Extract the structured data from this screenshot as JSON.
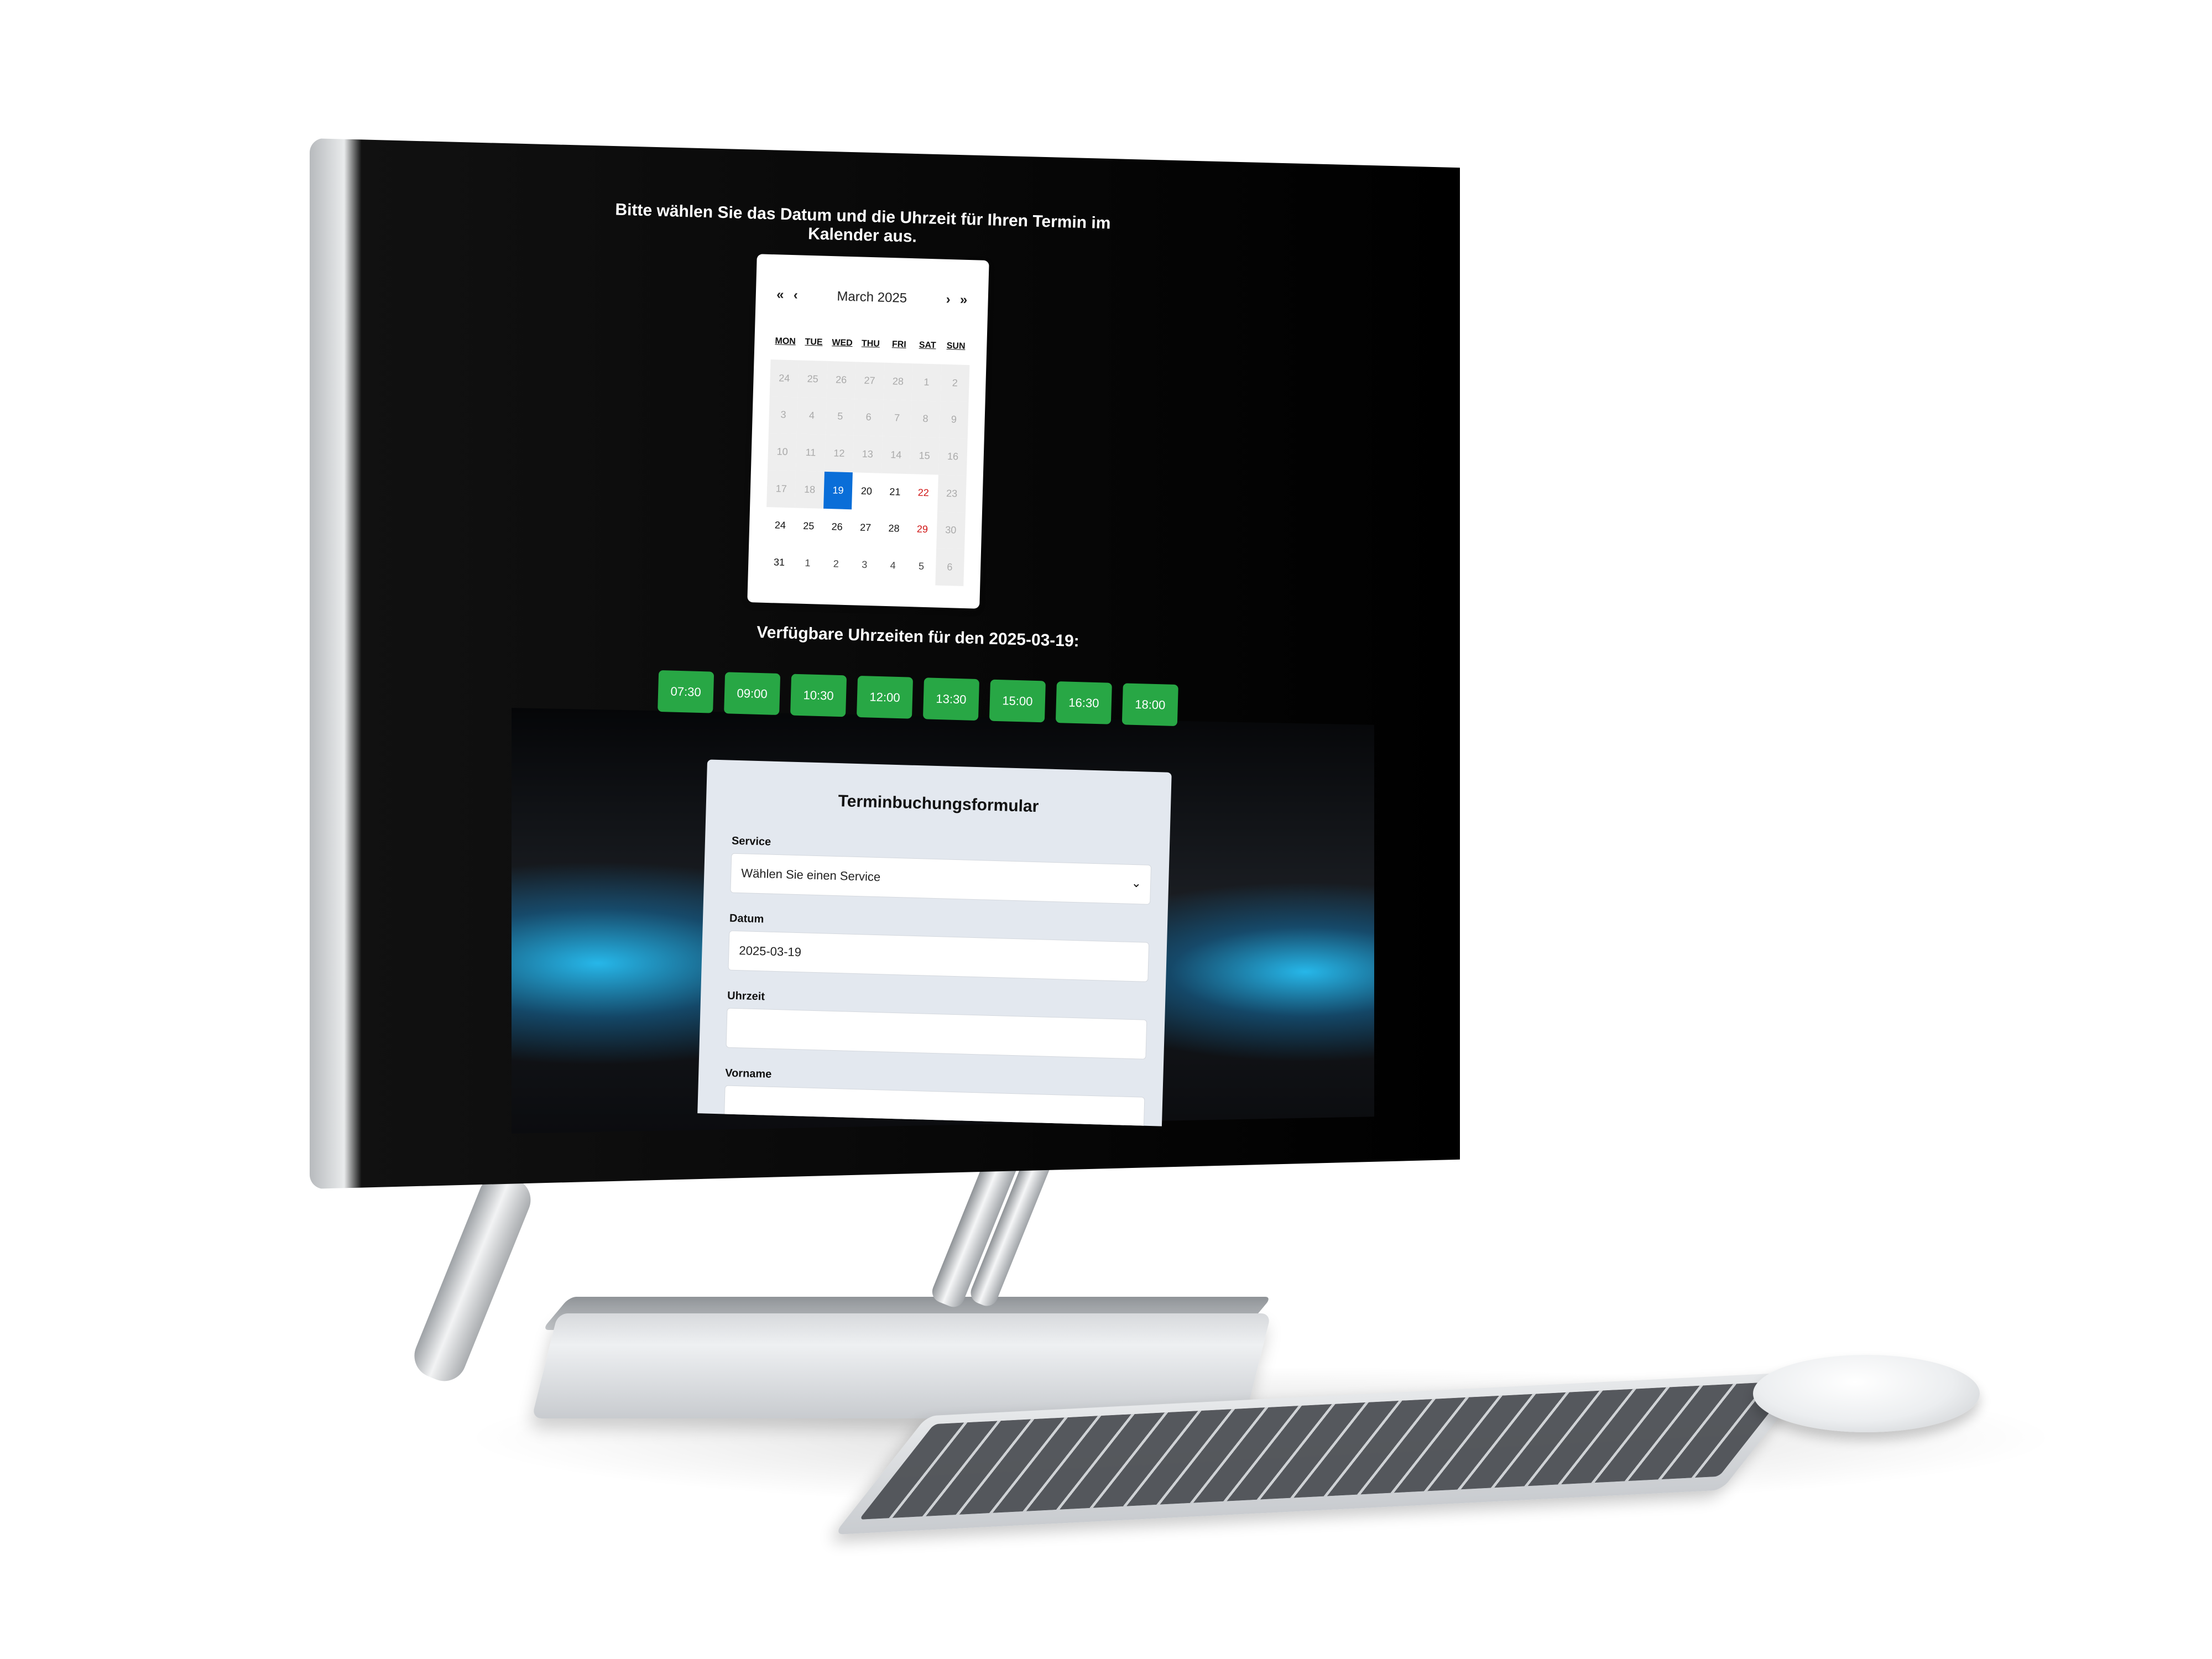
{
  "page": {
    "title": "Bitte wählen Sie das Datum und die Uhrzeit für Ihren Termin im Kalender aus."
  },
  "calendar": {
    "nav": {
      "prev_year": "«",
      "prev_month": "‹",
      "next_month": "›",
      "next_year": "»"
    },
    "month_label": "March 2025",
    "weekdays": [
      "MON",
      "TUE",
      "WED",
      "THU",
      "FRI",
      "SAT",
      "SUN"
    ],
    "days": [
      {
        "label": "24",
        "state": "other past"
      },
      {
        "label": "25",
        "state": "other past"
      },
      {
        "label": "26",
        "state": "other past"
      },
      {
        "label": "27",
        "state": "other past"
      },
      {
        "label": "28",
        "state": "other past"
      },
      {
        "label": "1",
        "state": "past"
      },
      {
        "label": "2",
        "state": "past"
      },
      {
        "label": "3",
        "state": "past"
      },
      {
        "label": "4",
        "state": "past"
      },
      {
        "label": "5",
        "state": "past"
      },
      {
        "label": "6",
        "state": "past"
      },
      {
        "label": "7",
        "state": "past"
      },
      {
        "label": "8",
        "state": "past"
      },
      {
        "label": "9",
        "state": "past"
      },
      {
        "label": "10",
        "state": "past"
      },
      {
        "label": "11",
        "state": "past"
      },
      {
        "label": "12",
        "state": "past"
      },
      {
        "label": "13",
        "state": "past"
      },
      {
        "label": "14",
        "state": "past"
      },
      {
        "label": "15",
        "state": "past"
      },
      {
        "label": "16",
        "state": "past"
      },
      {
        "label": "17",
        "state": "past"
      },
      {
        "label": "18",
        "state": "past"
      },
      {
        "label": "19",
        "state": "selected"
      },
      {
        "label": "20",
        "state": ""
      },
      {
        "label": "21",
        "state": ""
      },
      {
        "label": "22",
        "state": "weekend"
      },
      {
        "label": "23",
        "state": "sunday-fade"
      },
      {
        "label": "24",
        "state": ""
      },
      {
        "label": "25",
        "state": ""
      },
      {
        "label": "26",
        "state": ""
      },
      {
        "label": "27",
        "state": ""
      },
      {
        "label": "28",
        "state": ""
      },
      {
        "label": "29",
        "state": "weekend"
      },
      {
        "label": "30",
        "state": "sunday-fade"
      },
      {
        "label": "31",
        "state": ""
      },
      {
        "label": "1",
        "state": "other"
      },
      {
        "label": "2",
        "state": "other"
      },
      {
        "label": "3",
        "state": "other"
      },
      {
        "label": "4",
        "state": "other"
      },
      {
        "label": "5",
        "state": "other"
      },
      {
        "label": "6",
        "state": "sunday-fade"
      }
    ]
  },
  "slots": {
    "title": "Verfügbare Uhrzeiten für den 2025-03-19:",
    "times": [
      "07:30",
      "09:00",
      "10:30",
      "12:00",
      "13:30",
      "15:00",
      "16:30",
      "18:00"
    ]
  },
  "form": {
    "title": "Terminbuchungsformular",
    "service": {
      "label": "Service",
      "value": "Wählen Sie einen Service"
    },
    "date": {
      "label": "Datum",
      "value": "2025-03-19"
    },
    "time": {
      "label": "Uhrzeit",
      "value": ""
    },
    "firstname": {
      "label": "Vorname",
      "value": ""
    }
  },
  "colors": {
    "slot_green": "#28a745",
    "selected_blue": "#0a6ed8",
    "weekend_red": "#d01515",
    "form_bg": "#e3e8ef"
  },
  "icons": {
    "select_chevron": "chevron-down-icon"
  }
}
